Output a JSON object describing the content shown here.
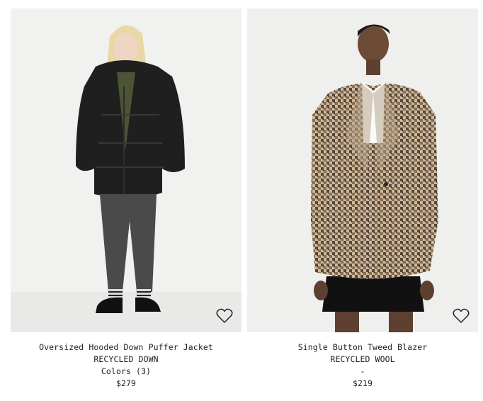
{
  "products": [
    {
      "name": "Oversized Hooded Down Puffer Jacket",
      "material": "RECYCLED DOWN",
      "colors": "Colors (3)",
      "price": "$279",
      "wishlist_icon": "heart-outline-icon"
    },
    {
      "name": "Single Button Tweed Blazer",
      "material": "RECYCLED WOOL",
      "colors": "-",
      "price": "$219",
      "wishlist_icon": "heart-outline-icon"
    }
  ]
}
